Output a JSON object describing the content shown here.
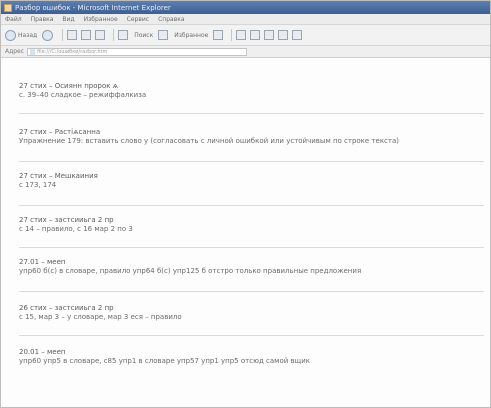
{
  "window": {
    "title": "Разбор ошибок - Microsoft Internet Explorer"
  },
  "menu": [
    "Файл",
    "Правка",
    "Вид",
    "Избранное",
    "Сервис",
    "Справка"
  ],
  "toolbar": {
    "back_label": "Назад",
    "search_label": "Поиск",
    "favorites_label": "Избранное"
  },
  "address": {
    "label": "Адрес",
    "url": "file:///C:/ошибки/razbor.htm"
  },
  "entries": [
    {
      "title": "27 стих – Осиянн пророк ѧ",
      "text": "с. 39–40 сладкое – режиффалкиза"
    },
    {
      "title": "27 стих – Растіѧсанна",
      "text": "Упражнение 179: вставить слово у (согласовать с личной ошибкой или устойчивым по строке текста)"
    },
    {
      "title": "27 стих – Мешкаиния",
      "text": "с 173, 174"
    },
    {
      "title": "27 стих – застсииьга 2 пр",
      "text": "с 14 – правило, с 16 мар 2 по 3"
    },
    {
      "title": "27.01 – мееп",
      "text": "упр60 б(с) в словаре, правило упр64 б(с) упр125 б отстро только правильные предложения"
    },
    {
      "title": "26 стих – застсииьга 2 пр",
      "text": "с 15, мар 3 – у словаре, мар 3 еся – правило"
    },
    {
      "title": "20.01 – мееп",
      "text": "упр60 упр5 в словаре, с85 упр1 в словаре упр57 упр1 упр5 отсюд самой вщик"
    }
  ]
}
